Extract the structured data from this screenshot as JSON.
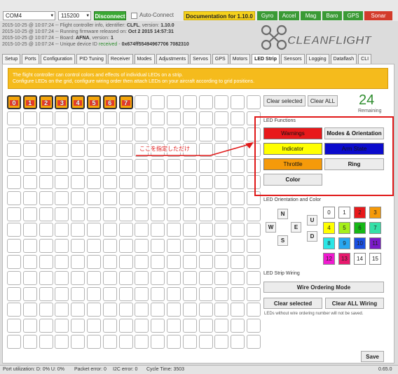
{
  "topbar": {
    "port": "COM4",
    "baud": "115200",
    "connect": "Disconnect",
    "auto_connect": "Auto-Connect",
    "documentation": "Documentation for 1.10.0",
    "sensors": [
      {
        "label": "Gyro",
        "color": "#3a9a35"
      },
      {
        "label": "Accel",
        "color": "#3a9a35"
      },
      {
        "label": "Mag",
        "color": "#3a9a35"
      },
      {
        "label": "Baro",
        "color": "#3a9a35"
      },
      {
        "label": "GPS",
        "color": "#3a9a35"
      },
      {
        "label": "Sonar",
        "color": "#d33b2b"
      }
    ]
  },
  "log": [
    {
      "prefix": "2015-10-25 @ 10:07:24 -- Flight controller info, identifier: ",
      "value": "CLFL",
      "suffix": ", version: ",
      "value2": "1.10.0"
    },
    {
      "prefix": "2015-10-25 @ 10:07:24 -- Running firmware released on: ",
      "value": "Oct 2 2015 14:57:31",
      "suffix": "",
      "value2": ""
    },
    {
      "prefix": "2015-10-25 @ 10:07:24 -- Board: ",
      "value": "AFNA",
      "suffix": ", version: ",
      "value2": "1"
    },
    {
      "prefix": "2015-10-25 @ 10:07:24 -- Unique device ID ",
      "value": "received",
      "suffix": " - ",
      "value2": "0x674ff55494967706 7082310"
    }
  ],
  "logo": "CLEANFLIGHT",
  "tabs": [
    "Setup",
    "Ports",
    "Configuration",
    "PID Tuning",
    "Receiver",
    "Modes",
    "Adjustments",
    "Servos",
    "GPS",
    "Motors",
    "LED Strip",
    "Sensors",
    "Logging",
    "Dataflash",
    "CLI"
  ],
  "active_tab": "LED Strip",
  "banner": {
    "line1": "The flight controller can control colors and effects of individual LEDs on a strip.",
    "line2": "Configure LEDs on the grid, configure wiring order then attach LEDs on your aircraft according to grid positions."
  },
  "grid": {
    "lit_labels": [
      "0",
      "1",
      "2",
      "3",
      "4",
      "5",
      "6",
      "7"
    ]
  },
  "buttons": {
    "clear_selected": "Clear selected",
    "clear_all": "Clear ALL"
  },
  "remaining": {
    "count": "24",
    "label": "Remaining"
  },
  "led_functions": {
    "title": "LED Functions",
    "items": [
      {
        "label": "Warnings",
        "bg": "#e8191b",
        "fg": "#111111"
      },
      {
        "label": "Modes & Orientation",
        "bg": "#ececec",
        "fg": "#111111"
      },
      {
        "label": "Indicator",
        "bg": "#ffff00",
        "fg": "#111111"
      },
      {
        "label": "Arm State",
        "bg": "#0b0bcc",
        "fg": "#111111"
      },
      {
        "label": "Throttle",
        "bg": "#f59a0a",
        "fg": "#111111"
      },
      {
        "label": "Ring",
        "bg": "#ececec",
        "fg": "#111111"
      },
      {
        "label": "Color",
        "bg": "#ececec",
        "fg": "#111111"
      }
    ]
  },
  "annotation": "ここを指定しただけ",
  "orientation": {
    "title": "LED Orientation and Color",
    "directions": [
      "N",
      "W",
      "E",
      "S",
      "U",
      "D"
    ],
    "colors": [
      {
        "label": "0",
        "bg": "#ffffff",
        "fg": "#222222"
      },
      {
        "label": "1",
        "bg": "#ffffff",
        "fg": "#222222"
      },
      {
        "label": "2",
        "bg": "#e8191b",
        "fg": "#222222"
      },
      {
        "label": "3",
        "bg": "#f59a0a",
        "fg": "#222222"
      },
      {
        "label": "4",
        "bg": "#ffff00",
        "fg": "#222222"
      },
      {
        "label": "5",
        "bg": "#a6f01a",
        "fg": "#222222"
      },
      {
        "label": "6",
        "bg": "#16b816",
        "fg": "#222222"
      },
      {
        "label": "7",
        "bg": "#35e0a8",
        "fg": "#222222"
      },
      {
        "label": "8",
        "bg": "#2ae6e6",
        "fg": "#222222"
      },
      {
        "label": "9",
        "bg": "#29a7f0",
        "fg": "#222222"
      },
      {
        "label": "10",
        "bg": "#1a4fe0",
        "fg": "#222222"
      },
      {
        "label": "11",
        "bg": "#7a1ac8",
        "fg": "#222222"
      },
      {
        "label": "12",
        "bg": "#f01ad0",
        "fg": "#222222"
      },
      {
        "label": "13",
        "bg": "#e8196e",
        "fg": "#222222"
      },
      {
        "label": "14",
        "bg": "#ffffff",
        "fg": "#222222"
      },
      {
        "label": "15",
        "bg": "#ffffff",
        "fg": "#222222"
      }
    ]
  },
  "wiring": {
    "title": "LED Strip Wiring",
    "wire_ordering": "Wire Ordering Mode",
    "clear_selected": "Clear selected",
    "clear_all_wiring": "Clear ALL Wiring",
    "note": "LEDs without wire ordering number will not be saved."
  },
  "save": "Save",
  "status": {
    "port_util": "Port utilization: D: 0% U: 0%",
    "packet_error": "Packet error: 0",
    "i2c_error": "I2C error: 0",
    "cycle_time": "Cycle Time: 3503",
    "version": "0.65.0"
  }
}
